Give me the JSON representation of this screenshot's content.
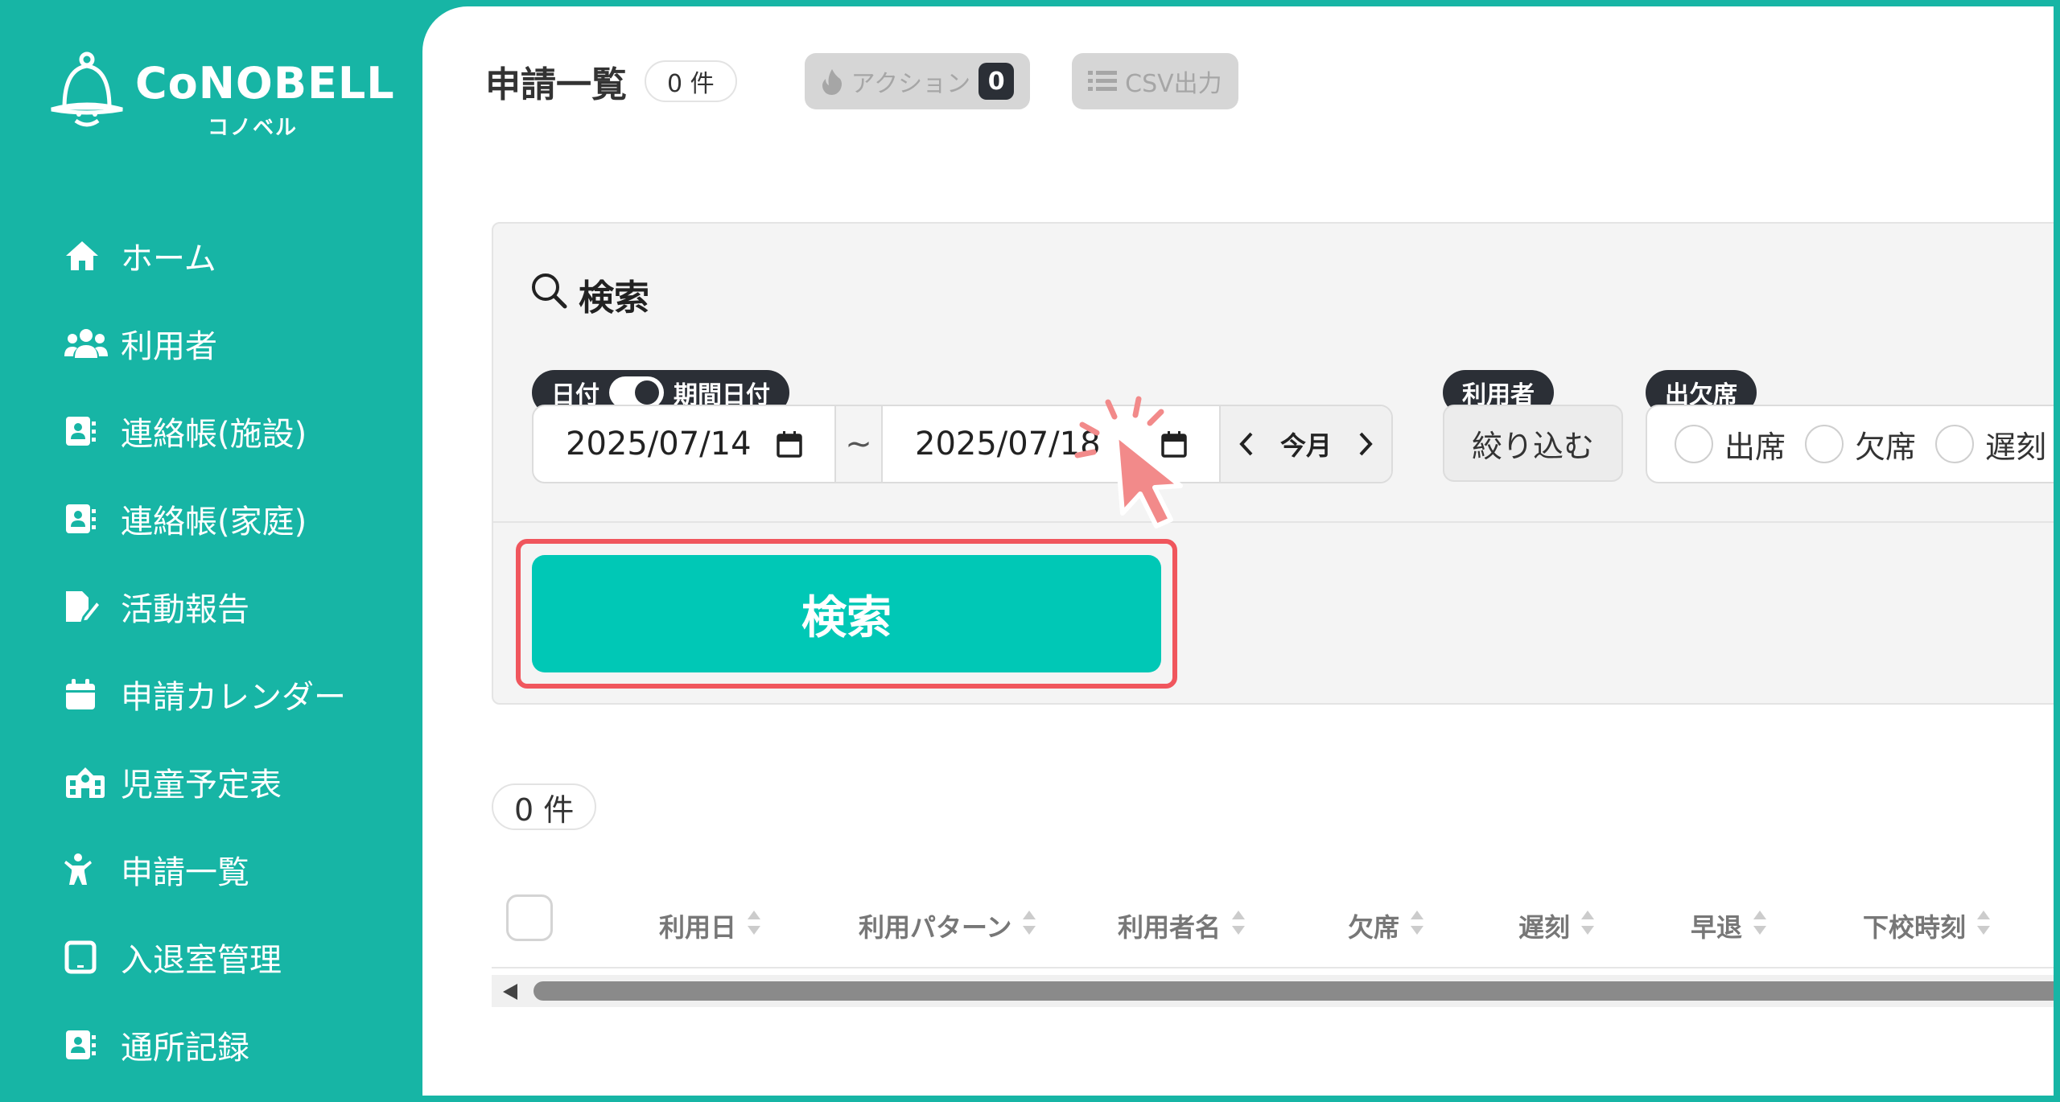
{
  "brand": {
    "name": "CoNOBELL",
    "sub": "コノベル"
  },
  "sidebar": {
    "items": [
      {
        "label": "ホーム",
        "icon": "home-icon"
      },
      {
        "label": "利用者",
        "icon": "users-icon"
      },
      {
        "label": "連絡帳(施設)",
        "icon": "contact-book-icon"
      },
      {
        "label": "連絡帳(家庭)",
        "icon": "contact-book-icon"
      },
      {
        "label": "活動報告",
        "icon": "report-icon"
      },
      {
        "label": "申請カレンダー",
        "icon": "calendar-icon"
      },
      {
        "label": "児童予定表",
        "icon": "school-icon"
      },
      {
        "label": "申請一覧",
        "icon": "child-icon"
      },
      {
        "label": "入退室管理",
        "icon": "tablet-icon"
      },
      {
        "label": "通所記録",
        "icon": "contact-book-icon"
      }
    ]
  },
  "header": {
    "title": "申請一覧",
    "count": "0 件",
    "action_label": "アクション",
    "action_count": "0",
    "csv_label": "CSV出力"
  },
  "search": {
    "title": "検索",
    "date_tag_left": "日付",
    "date_tag_right": "期間日付",
    "date_from": "2025/07/14",
    "tilde": "~",
    "date_to": "2025/07/18",
    "month_label": "今月",
    "user_tag": "利用者",
    "filter_label": "絞り込む",
    "attendance_tag": "出欠席",
    "attendance_options": [
      "出席",
      "欠席",
      "遅刻"
    ],
    "submit_label": "検索"
  },
  "results": {
    "count": "0 件",
    "columns": [
      "利用日",
      "利用パターン",
      "利用者名",
      "欠席",
      "遅刻",
      "早退",
      "下校時刻"
    ]
  },
  "colors": {
    "brand": "#17b5a5",
    "accent": "#00c8b6",
    "highlight": "#f0565d",
    "dark": "#2b2f36"
  }
}
